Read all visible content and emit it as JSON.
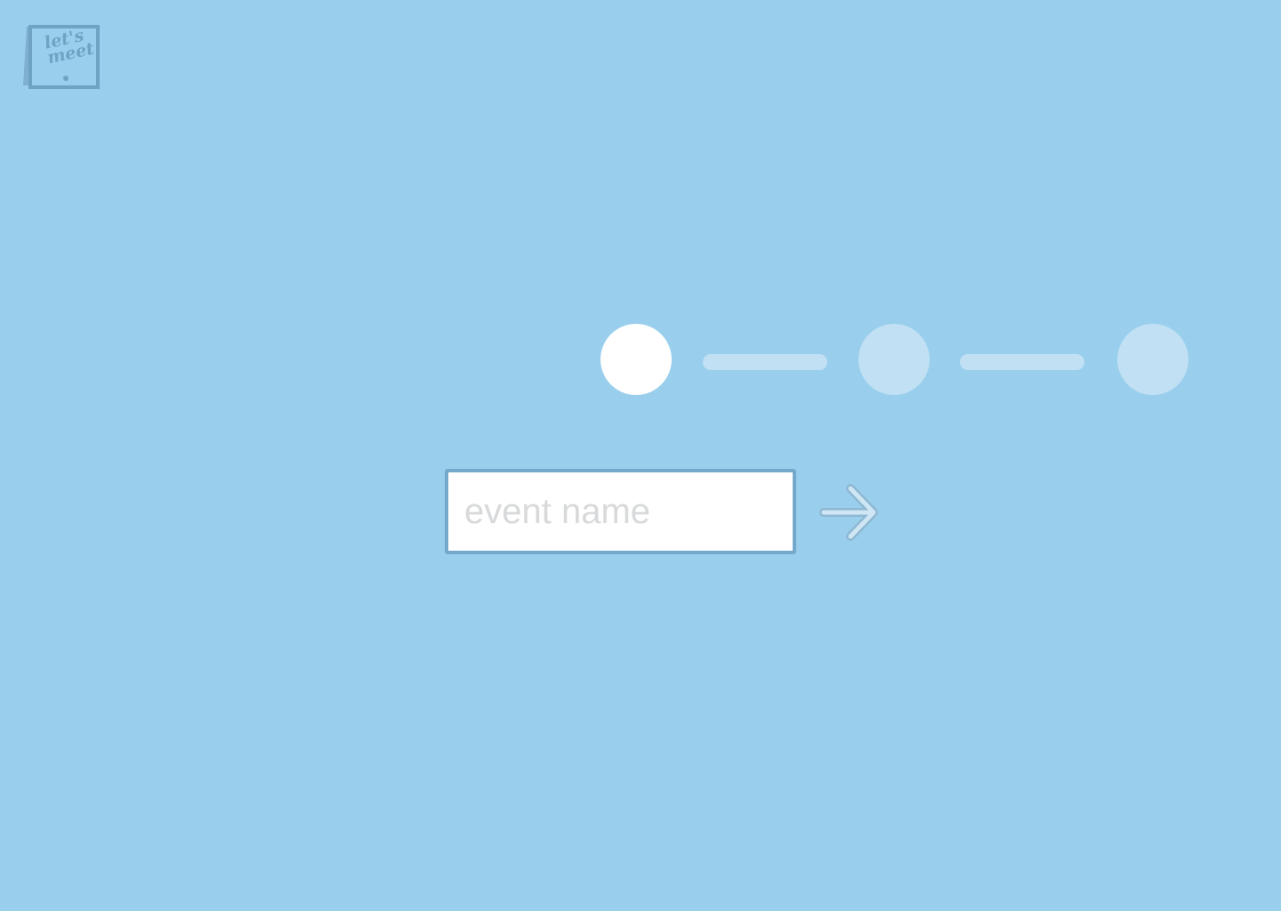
{
  "app": {
    "logo_text_line1": "let's",
    "logo_text_line2": "meet"
  },
  "stepper": {
    "steps_total": 3,
    "current_step": 1
  },
  "form": {
    "event_name_placeholder": "event name",
    "event_name_value": ""
  },
  "icons": {
    "next": "arrow-right-icon"
  },
  "colors": {
    "background": "#99CFED",
    "step_active": "#FFFFFF",
    "step_inactive": "#C1E0F4",
    "input_border": "#74A9CB",
    "logo": "#6FA3C3"
  }
}
